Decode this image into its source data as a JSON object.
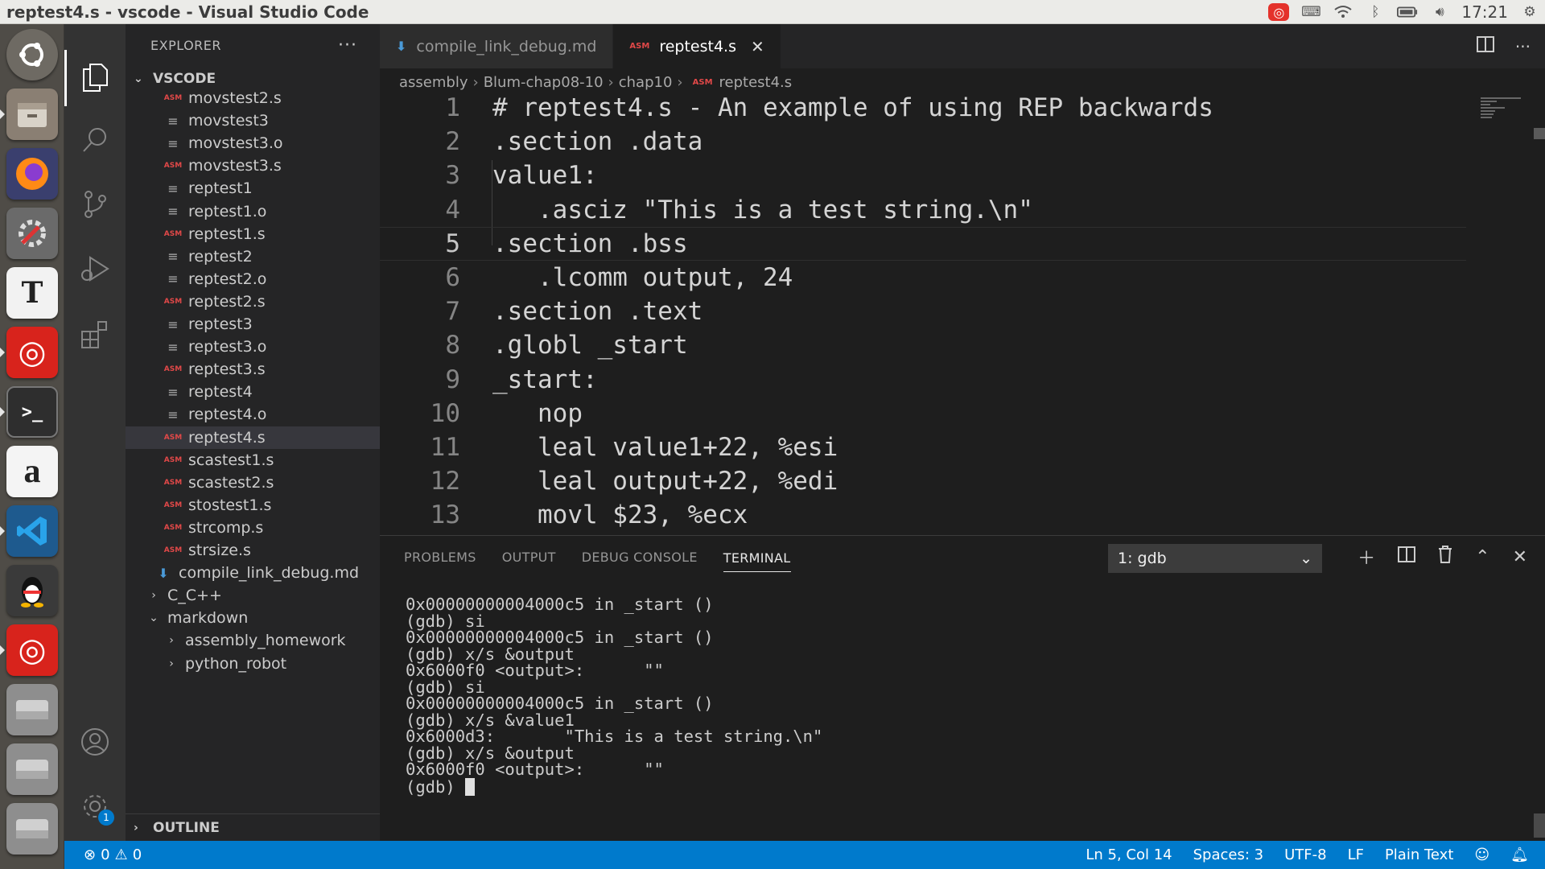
{
  "window": {
    "title": "reptest4.s - vscode - Visual Studio Code"
  },
  "tray": {
    "clock": "17:21",
    "icons": [
      "netease-music-icon",
      "keyboard-icon",
      "wifi-icon",
      "bluetooth-icon",
      "battery-icon",
      "volume-icon",
      "settings-gear-icon"
    ]
  },
  "launcher": {
    "apps": [
      "ubuntu-dash",
      "files",
      "firefox",
      "system-settings",
      "typora",
      "netease-music",
      "terminal",
      "amazon",
      "vscode",
      "qq",
      "netease-music",
      "drive",
      "drive",
      "drive"
    ]
  },
  "activity_bar": {
    "settings_badge": "1"
  },
  "sidebar": {
    "title": "EXPLORER",
    "more": "···",
    "root": "VSCODE",
    "files": [
      {
        "name": "movstest2.s",
        "type": "asm"
      },
      {
        "name": "movstest3",
        "type": "txt"
      },
      {
        "name": "movstest3.o",
        "type": "txt"
      },
      {
        "name": "movstest3.s",
        "type": "asm"
      },
      {
        "name": "reptest1",
        "type": "txt"
      },
      {
        "name": "reptest1.o",
        "type": "txt"
      },
      {
        "name": "reptest1.s",
        "type": "asm"
      },
      {
        "name": "reptest2",
        "type": "txt"
      },
      {
        "name": "reptest2.o",
        "type": "txt"
      },
      {
        "name": "reptest2.s",
        "type": "asm"
      },
      {
        "name": "reptest3",
        "type": "txt"
      },
      {
        "name": "reptest3.o",
        "type": "txt"
      },
      {
        "name": "reptest3.s",
        "type": "asm"
      },
      {
        "name": "reptest4",
        "type": "txt"
      },
      {
        "name": "reptest4.o",
        "type": "txt"
      },
      {
        "name": "reptest4.s",
        "type": "asm",
        "selected": true
      },
      {
        "name": "scastest1.s",
        "type": "asm"
      },
      {
        "name": "scastest2.s",
        "type": "asm"
      },
      {
        "name": "stostest1.s",
        "type": "asm"
      },
      {
        "name": "strcomp.s",
        "type": "asm"
      },
      {
        "name": "strsize.s",
        "type": "asm"
      }
    ],
    "md_file": "compile_link_debug.md",
    "folders": [
      {
        "name": "C_C++",
        "state": "collapsed"
      },
      {
        "name": "markdown",
        "state": "expanded"
      },
      {
        "name": "assembly_homework",
        "state": "collapsed"
      },
      {
        "name": "python_robot",
        "state": "collapsed"
      }
    ],
    "outline": "OUTLINE",
    "asm_label": "ASM"
  },
  "tabs": [
    {
      "label": "compile_link_debug.md",
      "type": "md",
      "active": false
    },
    {
      "label": "reptest4.s",
      "type": "asm",
      "active": true
    }
  ],
  "breadcrumb": [
    "assembly",
    "Blum-chap08-10",
    "chap10",
    "reptest4.s"
  ],
  "editor": {
    "current_line": 5,
    "lines": [
      {
        "n": "1",
        "text": "# reptest4.s - An example of using REP backwards"
      },
      {
        "n": "2",
        "text": ".section .data"
      },
      {
        "n": "3",
        "text": "value1:"
      },
      {
        "n": "4",
        "text": "   .asciz \"This is a test string.\\n\""
      },
      {
        "n": "5",
        "text": ".section .bss"
      },
      {
        "n": "6",
        "text": "   .lcomm output, 24"
      },
      {
        "n": "7",
        "text": ".section .text"
      },
      {
        "n": "8",
        "text": ".globl _start"
      },
      {
        "n": "9",
        "text": "_start:"
      },
      {
        "n": "10",
        "text": "   nop"
      },
      {
        "n": "11",
        "text": "   leal value1+22, %esi"
      },
      {
        "n": "12",
        "text": "   leal output+22, %edi"
      },
      {
        "n": "13",
        "text": "   movl $23, %ecx"
      }
    ]
  },
  "panel": {
    "tabs": [
      "PROBLEMS",
      "OUTPUT",
      "DEBUG CONSOLE",
      "TERMINAL"
    ],
    "active_tab": "TERMINAL",
    "terminal_select": "1: gdb",
    "terminal_lines": [
      "0x00000000004000c5 in _start ()",
      "(gdb) si",
      "0x00000000004000c5 in _start ()",
      "(gdb) x/s &output",
      "0x6000f0 <output>:      \"\"",
      "(gdb) si",
      "0x00000000004000c5 in _start ()",
      "(gdb) x/s &value1",
      "0x6000d3:       \"This is a test string.\\n\"",
      "(gdb) x/s &output",
      "0x6000f0 <output>:      \"\""
    ],
    "prompt": "(gdb) "
  },
  "status_bar": {
    "errors": "0",
    "warnings": "0",
    "position": "Ln 5, Col 14",
    "spaces": "Spaces: 3",
    "encoding": "UTF-8",
    "eol": "LF",
    "language": "Plain Text"
  }
}
